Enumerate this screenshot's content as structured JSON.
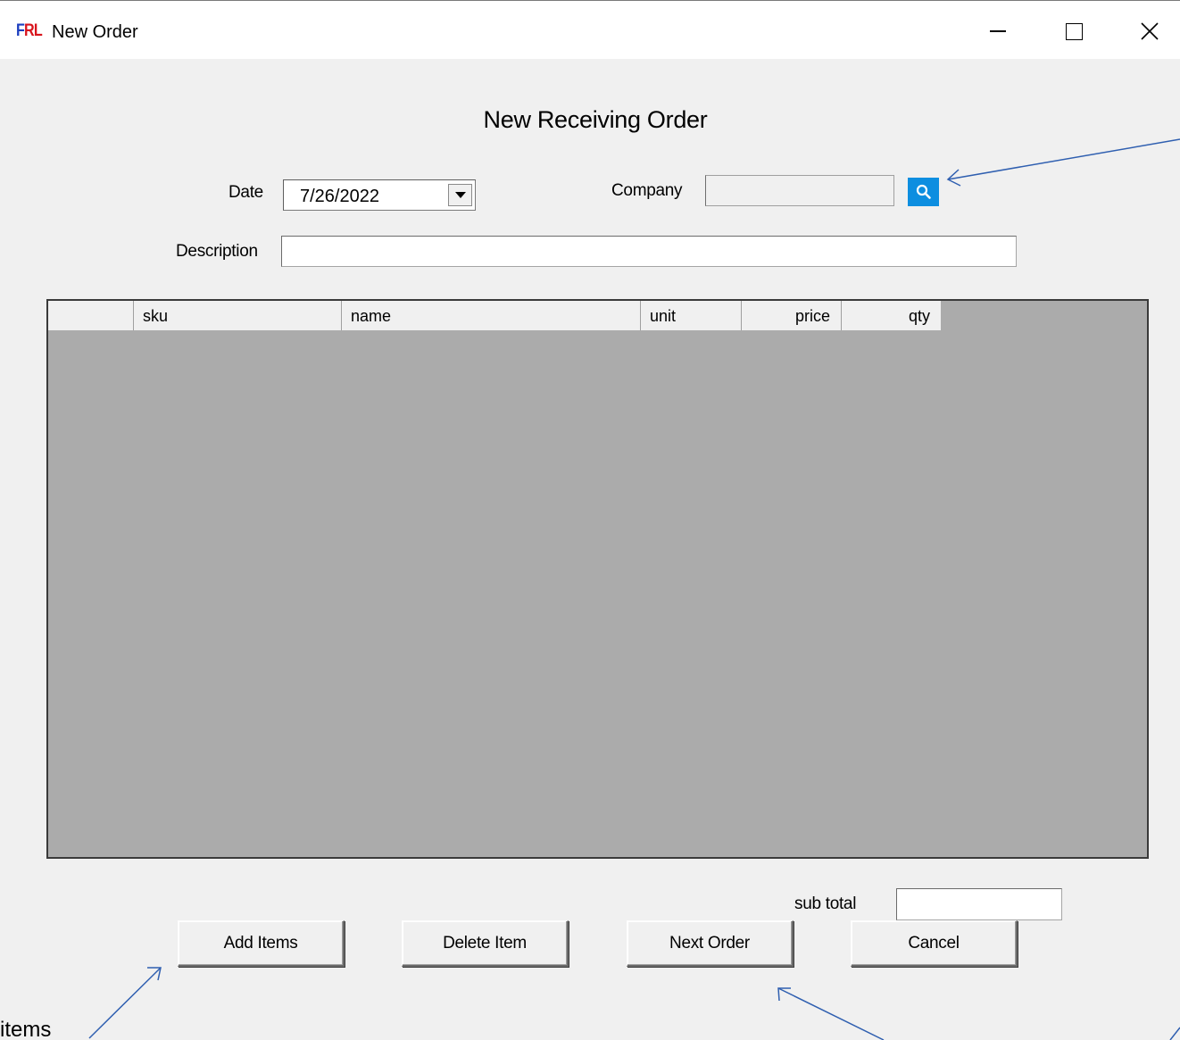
{
  "window": {
    "title": "New Order",
    "logo_text": "FRL"
  },
  "form": {
    "title": "New Receiving Order",
    "date_label": "Date",
    "date_value": "7/26/2022",
    "company_label": "Company",
    "company_value": "",
    "description_label": "Description",
    "description_value": ""
  },
  "grid": {
    "columns": [
      "",
      "sku",
      "name",
      "unit",
      "price",
      "qty"
    ],
    "rows": []
  },
  "footer": {
    "subtotal_label": "sub total",
    "subtotal_value": "",
    "buttons": {
      "add": "Add Items",
      "delete": "Delete Item",
      "next": "Next Order",
      "cancel": "Cancel"
    }
  },
  "annotation": {
    "items_text": "items"
  },
  "colors": {
    "search_button": "#0d8ee0",
    "grid_background": "#ababab",
    "annotation_arrow": "#2f5fb0",
    "logo_blue": "#1d3fbf",
    "logo_red": "#d8141c"
  },
  "icons": {
    "company_search": "search-icon",
    "minimize": "minimize-icon",
    "maximize": "maximize-icon",
    "close": "close-icon",
    "date_dropdown": "chevron-down-icon"
  }
}
